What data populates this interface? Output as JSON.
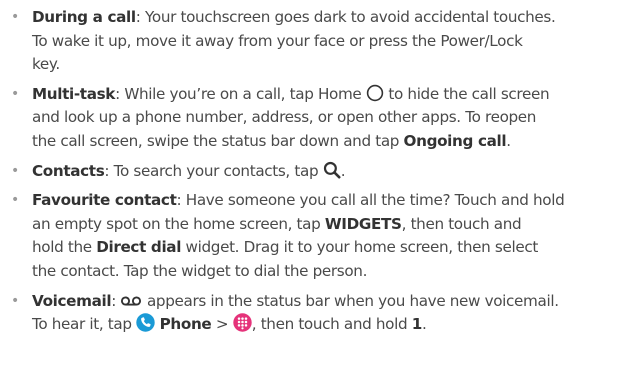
{
  "tips": [
    {
      "title": "During a call",
      "sep": ":",
      "lines": [
        "Your touchscreen goes dark to avoid accidental touches.",
        "To wake it up, move it away from your face or press the Power/Lock",
        "key."
      ]
    },
    {
      "title": "Multi-task",
      "sep": ":",
      "l1_a": "While you’re on a call, tap Home",
      "l1_b": "to hide the call screen",
      "l2": "and look up a phone number, address, or open other apps. To reopen",
      "l3_a": "the call screen, swipe the status bar down and tap",
      "l3_b": "Ongoing call",
      "l3_c": "."
    },
    {
      "title": "Contacts",
      "sep": ":",
      "l1_a": "To search your contacts, tap",
      "l1_b": "."
    },
    {
      "title": "Favourite contact",
      "sep": ":",
      "l1": "Have someone you call all the time? Touch and hold",
      "l2_a": "an empty spot on the home screen, tap",
      "l2_b": "WIDGETS",
      "l2_c": ", then touch and",
      "l3_a": "hold the",
      "l3_b": "Direct dial",
      "l3_c": "widget. Drag it to your home screen, then select",
      "l4": "the contact. Tap the widget to dial the person."
    },
    {
      "title": "Voicemail",
      "sep": ":",
      "l1": "appears in the status bar when you have new voicemail.",
      "l2_a": "To hear it, tap",
      "l2_b": "Phone",
      "l2_c": ">",
      "l2_d": ", then touch and hold",
      "l2_e": "1",
      "l2_f": "."
    }
  ],
  "bullet_char": "•",
  "colors": {
    "text": "#4a4a4a",
    "bold": "#333333",
    "bullet": "#9a9a9a",
    "phone_icon": "#1a9ad6",
    "dialpad_icon": "#e5337a"
  },
  "icons": [
    "home-circle-icon",
    "search-icon",
    "voicemail-icon",
    "phone-app-icon",
    "dialpad-icon"
  ]
}
